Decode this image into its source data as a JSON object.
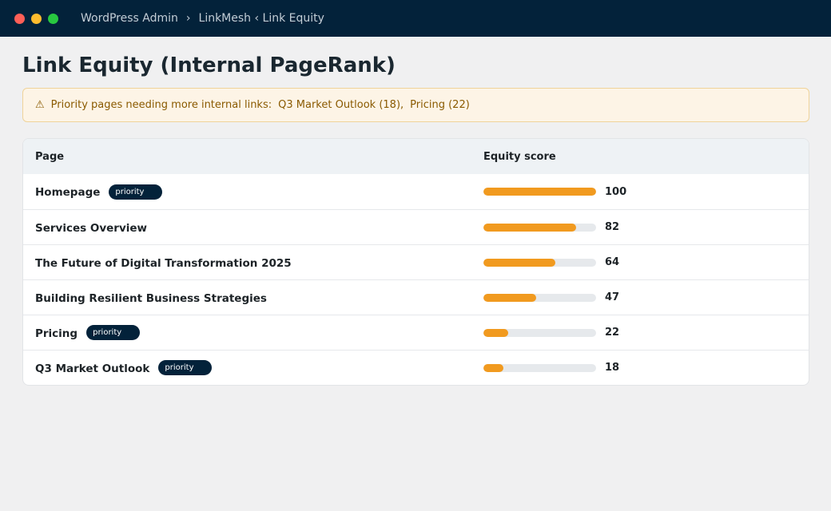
{
  "window": {
    "breadcrumb": [
      "WordPress Admin",
      "LinkMesh ‹ Link Equity"
    ],
    "breadcrumb_separator": "›"
  },
  "page": {
    "title": "Link Equity (Internal PageRank)"
  },
  "notice": {
    "icon": "⚠",
    "label": "Priority pages needing more internal links:",
    "items": [
      "Q3 Market Outlook (18),",
      "Pricing (22)"
    ]
  },
  "table": {
    "headers": {
      "page": "Page",
      "score": "Equity score"
    },
    "rows": [
      {
        "page": "Homepage",
        "badge": "priority",
        "score": "100",
        "fill": 1.0
      },
      {
        "page": "Services Overview",
        "badge": null,
        "score": "82",
        "fill": 0.82
      },
      {
        "page": "The Future of Digital Transformation 2025",
        "badge": null,
        "score": "64",
        "fill": 0.64
      },
      {
        "page": "Building Resilient Business Strategies",
        "badge": null,
        "score": "47",
        "fill": 0.47
      },
      {
        "page": "Pricing",
        "badge": "priority",
        "score": "22",
        "fill": 0.22
      },
      {
        "page": "Q3 Market Outlook",
        "badge": "priority",
        "score": "18",
        "fill": 0.18
      }
    ]
  },
  "colors": {
    "titlebar": "#03223a",
    "bar_fill": "#f19a1f",
    "bar_track": "#e6e9ec",
    "notice_bg": "#fdf4e6",
    "notice_text": "#8a5a00"
  }
}
